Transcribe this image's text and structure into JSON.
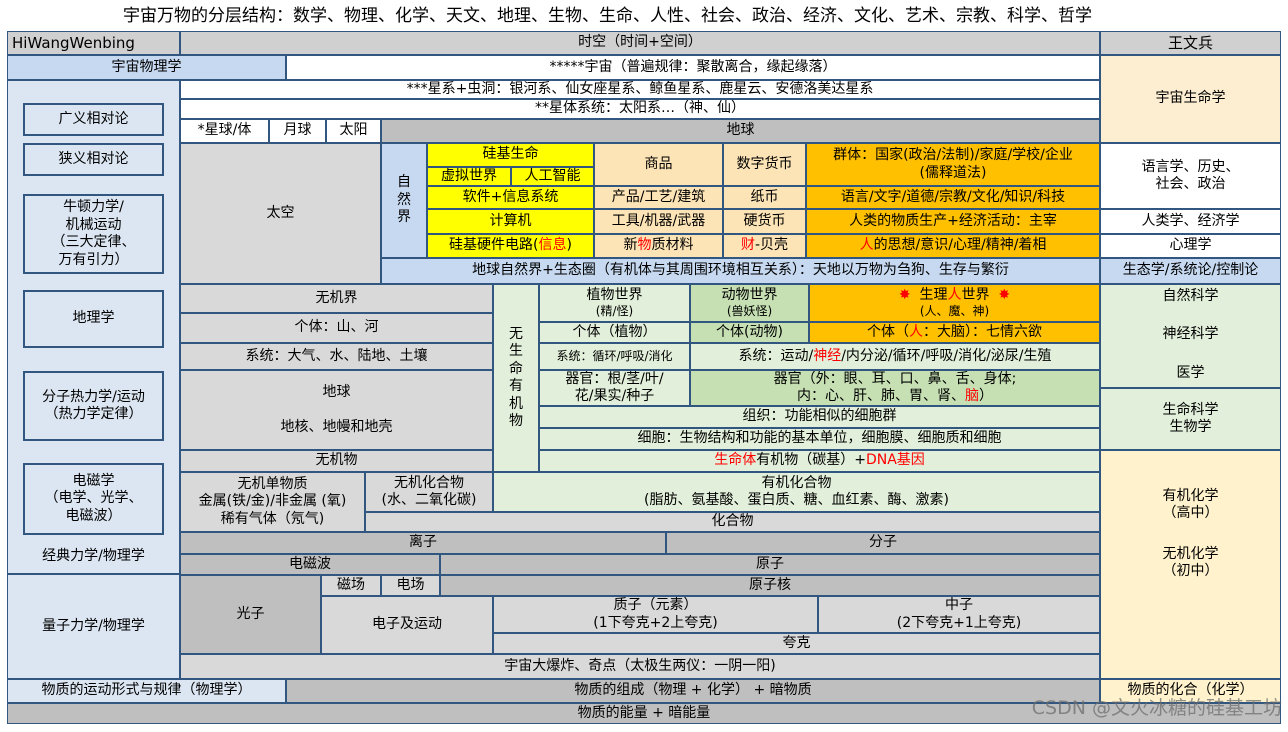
{
  "page_title": "宇宙万物的分层结构：数学、物理、化学、天文、地理、生物、生命、人性、社会、政治、经济、文化、艺术、宗教、科学、哲学",
  "header": {
    "left": "HiWangWenbing",
    "center": "时空（时间+空间）",
    "right": "王文兵"
  },
  "left_column": {
    "top": "宇宙物理学",
    "items": [
      "广义相对论",
      "狭义相对论",
      "牛顿力学/\n机械运动\n（三大定律、\n万有引力）",
      "地理学",
      "分子热力学/运动\n（热力学定律）",
      "电磁学\n（电学、光学、\n电磁波）"
    ],
    "classical": "经典力学/物理学",
    "quantum": "量子力学/物理学",
    "bottom": "物质的运动形式与规律（物理学）"
  },
  "right_column": {
    "items": [
      "宇宙生命学",
      "语言学、历史、\n社会、政治",
      "人类学、经济学",
      "心理学",
      "生态学/系统论/控制论",
      "自然科学",
      "神经科学",
      "医学",
      "生命科学\n生物学",
      "有机化学\n（高中）",
      "无机化学\n（初中）"
    ],
    "bottom": "物质的化合（化学）"
  },
  "cosmos": {
    "universe": "*****宇宙（普遍规律：聚散离合，缘起缘落）",
    "galaxies": "***星系+虫洞：银河系、仙女座星系、鲸鱼星系、鹿星云、安德洛美达星系",
    "star_system": "**星体系统：太阳系…（神、仙）",
    "planet": "*星球/体",
    "moon": "月球",
    "sun": "太阳",
    "earth": "地球",
    "space": "太空"
  },
  "earth_upper": {
    "nature_label": "自\n然\n界",
    "silicon_life": "硅基生命",
    "virtual_world": "虚拟世界",
    "ai": "人工智能",
    "software": "软件+信息系统",
    "computer": "计算机",
    "hardware_pre": "硅基硬件电路(",
    "hardware_red": "信息",
    "hardware_post": ")",
    "goods": "商品",
    "digital_currency": "数字货币",
    "groups": "群体：国家(政治/法制)/家庭/学校/企业\n(儒释道法)",
    "products": "产品/工艺/建筑",
    "paper_money": "纸币",
    "culture": "语言/文字/道德/宗教/文化/知识/科技",
    "tools": "工具/机器/武器",
    "coins": "硬货币",
    "production": "人类的物质生产+经济活动：主宰",
    "materials_pre": "新",
    "materials_red": "物",
    "materials_post": "质材料",
    "shells_red": "财",
    "shells_post": "-贝壳",
    "mind_red": "人",
    "mind_post": "的思想/意识/心理/精神/着相",
    "ecosphere": "地球自然界+生态圈（有机体与其周围环境相互关系）：天地以万物为刍狗、生存与繁衍"
  },
  "earth_lower": {
    "inorganic_world": "无机界",
    "mountains": "个体：山、河",
    "systems_inorg": "系统：大气、水、陆地、土壤",
    "earth2": "地球\n\n地核、地幔和地壳",
    "inorganic_matter": "无机物",
    "organic_label": "无\n生\n命\n有\n机\n物",
    "plant_world": "植物世界",
    "plant_sub": "(精/怪)",
    "animal_world": "动物世界",
    "animal_sub": "(兽妖怪)",
    "human_star_l": "✸",
    "human_pre": "生理",
    "human_red": "人",
    "human_post": "世界",
    "human_star_r": "✸",
    "human_sub": "(人、魔、神)",
    "plant_indiv": "个体（植物）",
    "animal_indiv": "个体(动物)",
    "human_indiv_pre": "个体（",
    "human_indiv_red": "人",
    "human_indiv_post": "：大脑）：七情六欲",
    "plant_system": "系统：循环/呼吸/消化",
    "animal_system_pre": "系统：运动/",
    "animal_system_red": "神经",
    "animal_system_post": "/内分泌/循环/呼吸/消化/泌尿/生殖",
    "plant_organs": "器官：根/茎/叶/\n花/果实/种子",
    "animal_organs_l1": "器官（外：眼、耳、口、鼻、舌、身体;",
    "animal_organs_l2_pre": "内：心、肝、肺、胃、肾、",
    "animal_organs_l2_red": "脑",
    "animal_organs_l2_post": "）",
    "tissue": "组织：功能相似的细胞群",
    "cell": "细胞：生物结构和功能的基本单位，细胞膜、细胞质和细胞",
    "organic_life_red": "生命体",
    "organic_life_mid": "有机物（碳基）+ ",
    "organic_life_red2": "DNA基因",
    "inorganic_elements": "无机单物质\n金属(铁/金)/非金属 (氧)\n稀有气体（氖气)",
    "inorganic_compounds": "无机化合物\n(水、二氧化碳)",
    "organic_compounds": "有机化合物\n(脂肪、氨基酸、蛋白质、糖、血红素、酶、激素)",
    "compounds": "化合物",
    "ions": "离子",
    "molecules": "分子",
    "em_waves": "电磁波",
    "atoms": "原子",
    "photons": "光子",
    "magnetic_field": "磁场",
    "electric_field": "电场",
    "nucleus": "原子核",
    "electrons": "电子及运动",
    "protons": "质子（元素）\n(1下夸克+2上夸克)",
    "neutrons": "中子\n(2下夸克+1上夸克)",
    "quarks": "夸克",
    "big_bang": "宇宙大爆炸、奇点（太极生两仪：一阴一阳)"
  },
  "bottom": {
    "composition": "物质的组成（物理 + 化学） + 暗物质",
    "energy": "物质的能量 + 暗能量"
  },
  "watermark": "CSDN @文火冰糖的硅基工坊"
}
